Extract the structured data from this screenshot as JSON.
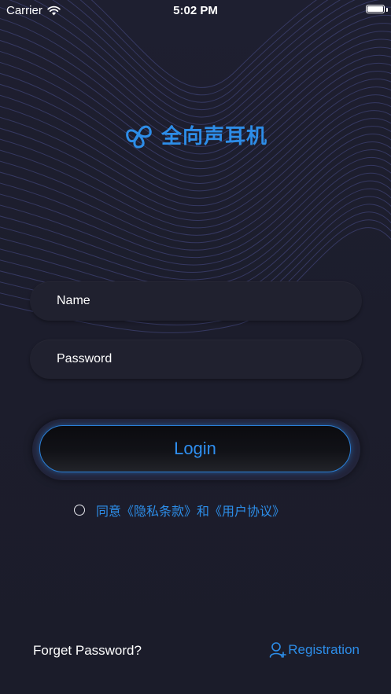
{
  "status_bar": {
    "carrier": "Carrier",
    "time": "5:02 PM",
    "wifi_icon": "wifi-icon",
    "battery_icon": "battery-icon"
  },
  "brand": {
    "name": "全向声耳机",
    "logo_icon": "logo-icon",
    "color": "#2d8de8"
  },
  "form": {
    "name_placeholder": "Name",
    "name_value": "",
    "password_placeholder": "Password",
    "password_value": "",
    "login_label": "Login"
  },
  "agreement": {
    "checked": false,
    "text": "同意《隐私条款》和《用户协议》"
  },
  "footer": {
    "forget_label": "Forget Password?",
    "registration_label": "Registration",
    "registration_icon": "add-user-icon"
  },
  "colors": {
    "accent": "#2d8de8",
    "background": "#1c1d2c",
    "field_background": "#20212f"
  }
}
